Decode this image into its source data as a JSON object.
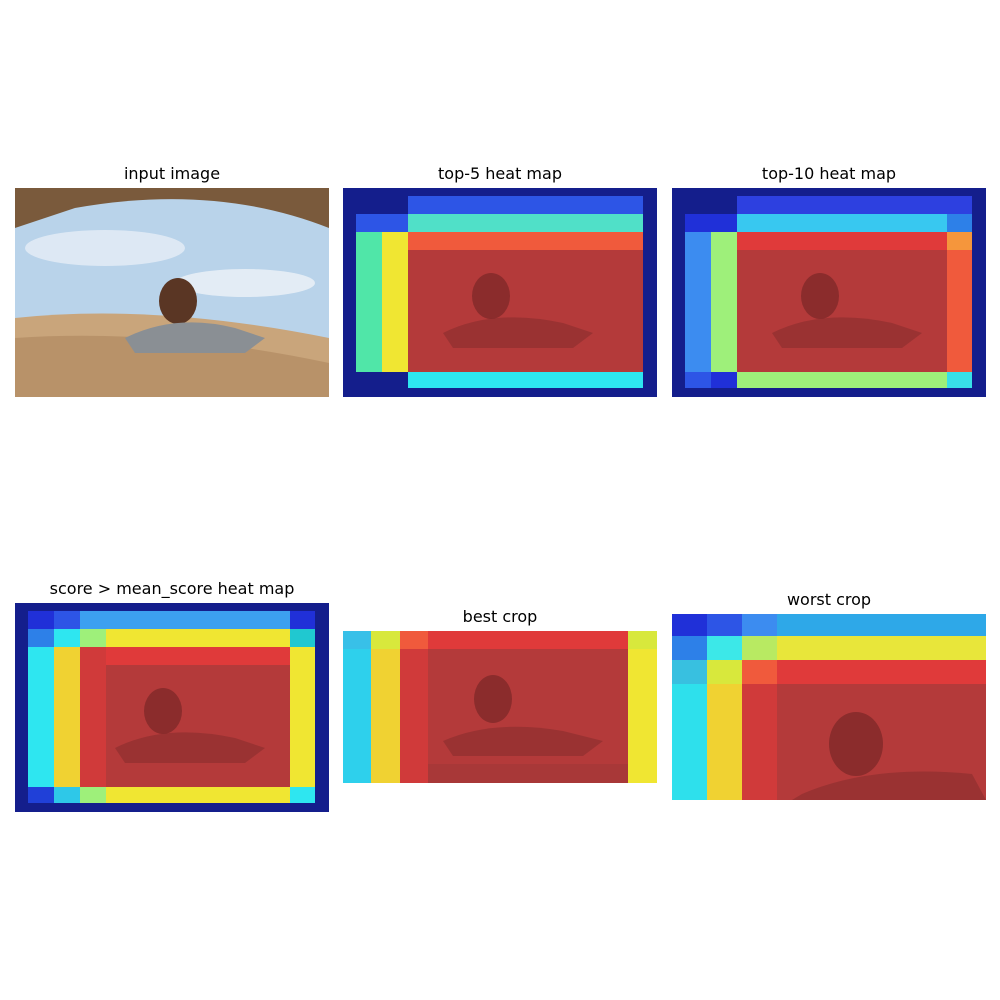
{
  "panels": [
    {
      "title": "input image",
      "kind": "photo"
    },
    {
      "title": "top-5 heat map",
      "kind": "heatmap"
    },
    {
      "title": "top-10 heat map",
      "kind": "heatmap"
    },
    {
      "title": "score > mean_score heat map",
      "kind": "heatmap"
    },
    {
      "title": "best crop",
      "kind": "crop"
    },
    {
      "title": "worst crop",
      "kind": "crop"
    }
  ],
  "colors": {
    "dark_blue": "#141e8c",
    "blue": "#2d55e6",
    "light_blue": "#3ca0f0",
    "cyan": "#2ee6f0",
    "green": "#9ef07a",
    "yellow": "#f0e632",
    "orange": "#f5963c",
    "red_orange": "#f05a3c",
    "red": "#c83232",
    "sky": "#a9c9e4",
    "sand": "#c8aa82"
  }
}
